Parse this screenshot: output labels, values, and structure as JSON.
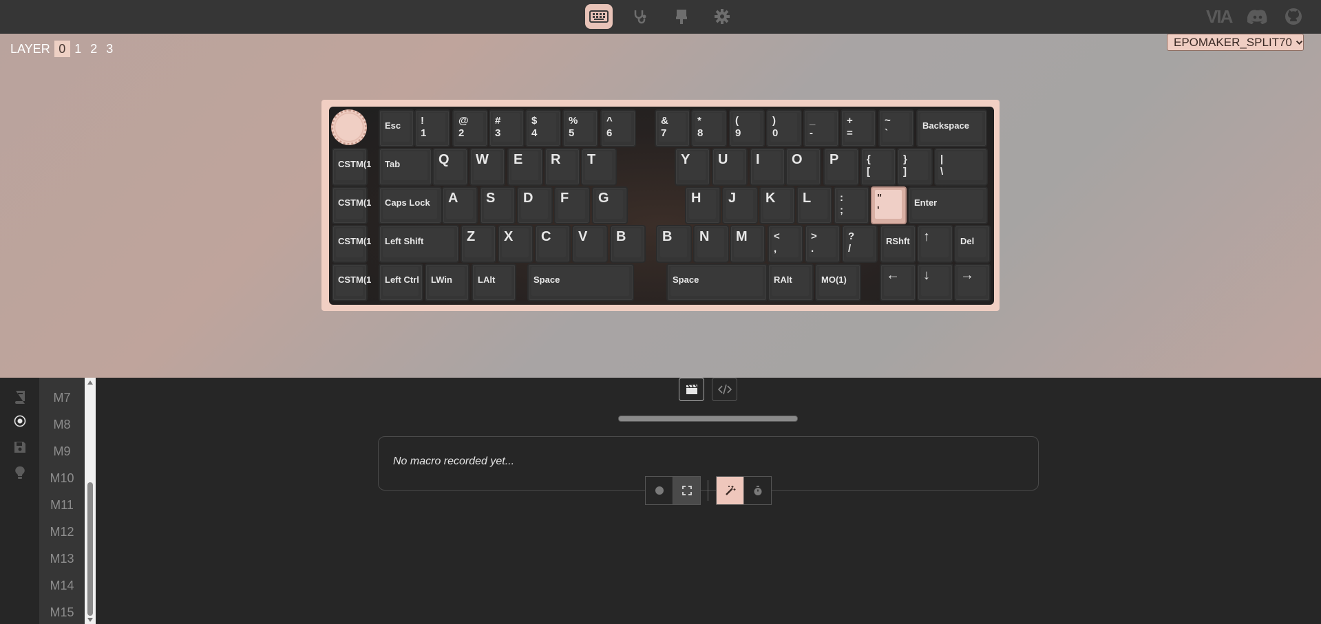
{
  "topbar": {
    "icons": [
      "keyboard-icon",
      "stethoscope-icon",
      "paintbrush-icon",
      "gear-icon"
    ],
    "right_icons": [
      "via-logo-icon",
      "discord-icon",
      "github-icon"
    ],
    "via_logo_text": "VIA"
  },
  "layer_selector": {
    "label": "LAYER",
    "layers": [
      "0",
      "1",
      "2",
      "3"
    ],
    "selected": "0"
  },
  "device_select": {
    "value": "EPOMAKER_SPLIT70"
  },
  "keyboard": {
    "row1": [
      {
        "label": "Esc"
      },
      {
        "label": "!\n1"
      },
      {
        "label": "@\n2"
      },
      {
        "label": "#\n3"
      },
      {
        "label": "$\n4"
      },
      {
        "label": "%\n5"
      },
      {
        "label": "^\n6"
      },
      {
        "label": "&\n7"
      },
      {
        "label": "*\n8"
      },
      {
        "label": "(\n9"
      },
      {
        "label": ")\n0"
      },
      {
        "label": "_\n-"
      },
      {
        "label": "+\n="
      },
      {
        "label": "~\n`"
      },
      {
        "label": "Backspace"
      }
    ],
    "row2": [
      {
        "label": "CSTM(1"
      },
      {
        "label": "Tab"
      },
      {
        "label": "Q"
      },
      {
        "label": "W"
      },
      {
        "label": "E"
      },
      {
        "label": "R"
      },
      {
        "label": "T"
      },
      {
        "label": "Y"
      },
      {
        "label": "U"
      },
      {
        "label": "I"
      },
      {
        "label": "O"
      },
      {
        "label": "P"
      },
      {
        "label": "{\n["
      },
      {
        "label": "}\n]"
      },
      {
        "label": "|\n\\"
      }
    ],
    "row3": [
      {
        "label": "CSTM(1"
      },
      {
        "label": "Caps Lock"
      },
      {
        "label": "A"
      },
      {
        "label": "S"
      },
      {
        "label": "D"
      },
      {
        "label": "F"
      },
      {
        "label": "G"
      },
      {
        "label": "H"
      },
      {
        "label": "J"
      },
      {
        "label": "K"
      },
      {
        "label": "L"
      },
      {
        "label": ":\n;"
      },
      {
        "label": "\"\n'"
      },
      {
        "label": "Enter"
      }
    ],
    "row4": [
      {
        "label": "CSTM(1"
      },
      {
        "label": "Left Shift"
      },
      {
        "label": "Z"
      },
      {
        "label": "X"
      },
      {
        "label": "C"
      },
      {
        "label": "V"
      },
      {
        "label": "B"
      },
      {
        "label": "B"
      },
      {
        "label": "N"
      },
      {
        "label": "M"
      },
      {
        "label": "<\n,"
      },
      {
        "label": ">\n."
      },
      {
        "label": "?\n/"
      },
      {
        "label": "RShft"
      },
      {
        "label": "↑"
      },
      {
        "label": "Del"
      }
    ],
    "row5": [
      {
        "label": "CSTM(1"
      },
      {
        "label": "Left Ctrl"
      },
      {
        "label": "LWin"
      },
      {
        "label": "LAlt"
      },
      {
        "label": "Space"
      },
      {
        "label": "Space"
      },
      {
        "label": "RAlt"
      },
      {
        "label": "MO(1)"
      },
      {
        "label": "←"
      },
      {
        "label": "↓"
      },
      {
        "label": "→"
      }
    ]
  },
  "sidebar": {
    "icons": [
      "book-icon",
      "record-icon",
      "save-icon",
      "lightbulb-icon"
    ],
    "active": "record-icon"
  },
  "macro_list": {
    "items": [
      "M7",
      "M8",
      "M9",
      "M10",
      "M11",
      "M12",
      "M13",
      "M14",
      "M15"
    ]
  },
  "macro_editor": {
    "tabs": [
      "clapperboard-icon",
      "code-icon"
    ],
    "empty_text": "No macro recorded yet...",
    "controls": [
      "record-dot-icon",
      "fullscreen-icon",
      "magic-wand-icon",
      "stopwatch-icon"
    ]
  },
  "colors": {
    "accent": "#efcfc6",
    "topbar": "#363636",
    "panel": "#262626"
  }
}
